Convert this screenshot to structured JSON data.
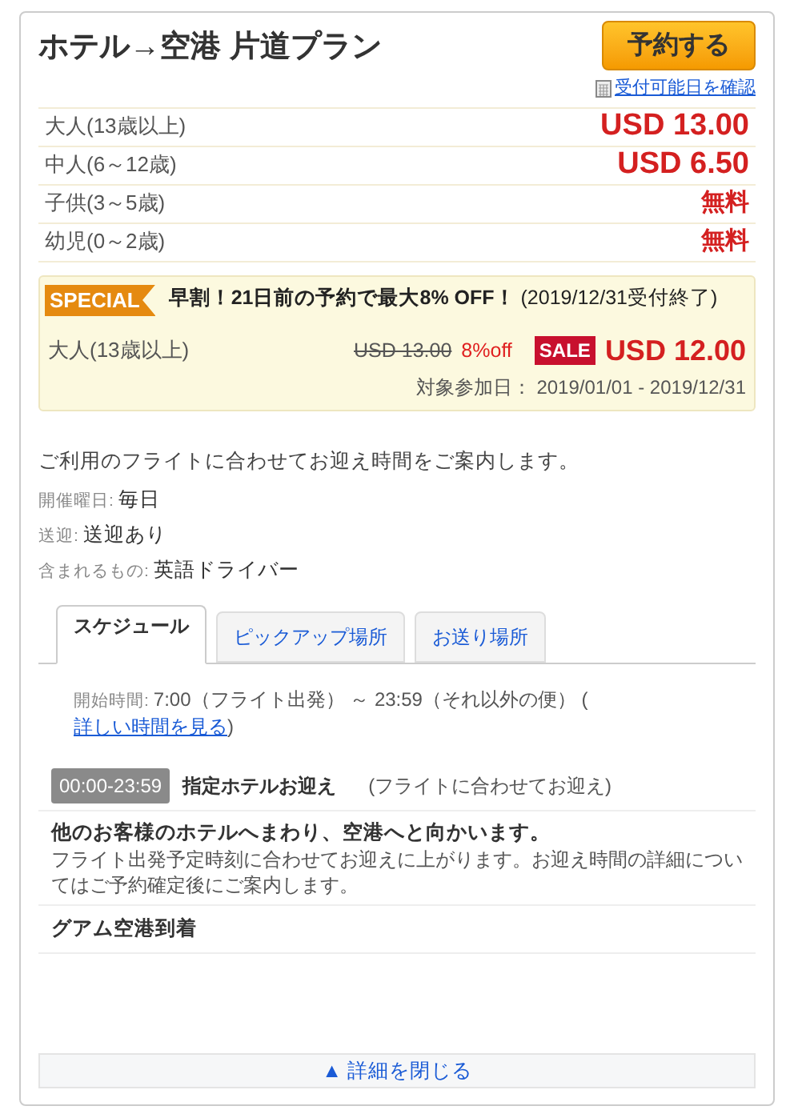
{
  "title": "ホテル→空港 片道プラン",
  "book_button": "予約する",
  "availability_link": "受付可能日を確認",
  "prices": [
    {
      "label": "大人(13歳以上)",
      "price": "USD 13.00",
      "kind": "amount"
    },
    {
      "label": "中人(6～12歳)",
      "price": "USD 6.50",
      "kind": "amount"
    },
    {
      "label": "子供(3～5歳)",
      "price": "無料",
      "kind": "free"
    },
    {
      "label": "幼児(0～2歳)",
      "price": "無料",
      "kind": "free"
    }
  ],
  "special": {
    "badge": "SPECIAL",
    "headline": "早割！21日前の予約で最大8% OFF！",
    "note": "(2019/12/31受付終了)",
    "label": "大人(13歳以上)",
    "original_price": "USD 13.00",
    "discount": "8%off",
    "sale_badge": "SALE",
    "sale_price": "USD 12.00",
    "period": "対象参加日： 2019/01/01 - 2019/12/31"
  },
  "description": "ご利用のフライトに合わせてお迎え時間をご案内します。",
  "details": [
    {
      "label": "開催曜日:",
      "value": "毎日"
    },
    {
      "label": "送迎:",
      "value": "送迎あり"
    },
    {
      "label": "含まれるもの:",
      "value": "英語ドライバー"
    }
  ],
  "tabs": [
    {
      "label": "スケジュール",
      "selected": true
    },
    {
      "label": "ピックアップ場所",
      "selected": false
    },
    {
      "label": "お送り場所",
      "selected": false
    }
  ],
  "schedule": {
    "start_label": "開始時間:",
    "start_value": "7:00（フライト出発） ～ 23:59（それ以外の便） (",
    "link": "詳しい時間を見る",
    "close": ")"
  },
  "timeline": [
    {
      "kind": "stop",
      "time": "00:00-23:59",
      "title": "指定ホテルお迎え",
      "note": "(フライトに合わせてお迎え)"
    },
    {
      "kind": "step",
      "title": "他のお客様のホテルへまわり、空港へと向かいます。",
      "text": "フライト出発予定時刻に合わせてお迎えに上がります。お迎え時間の詳細についてはご予約確定後にご案内します。"
    },
    {
      "kind": "arrival",
      "title": "グアム空港到着"
    }
  ],
  "collapse_button": "▲ 詳細を閉じる"
}
